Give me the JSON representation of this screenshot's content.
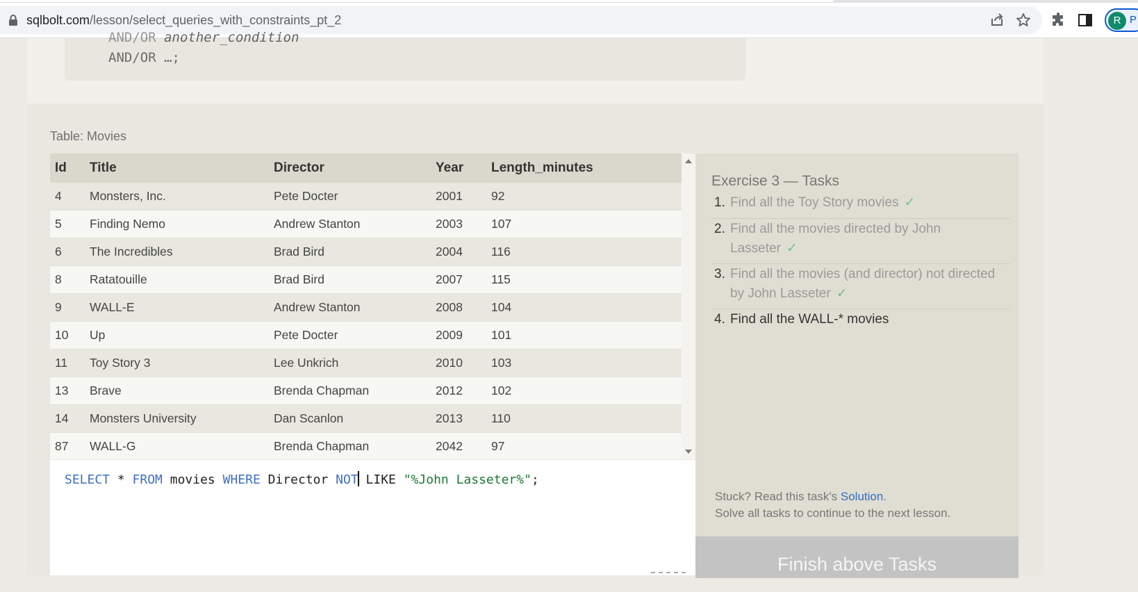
{
  "browser": {
    "url_host": "sqlbolt.com",
    "url_path": "/lesson/select_queries_with_constraints_pt_2",
    "profile_initial": "R",
    "profile_label_partial": "P"
  },
  "syntax_block": {
    "line1_kw": "AND/OR",
    "line1_italic": "another_condition",
    "line2": "AND/OR …;"
  },
  "table": {
    "label": "Table: Movies",
    "columns": [
      "Id",
      "Title",
      "Director",
      "Year",
      "Length_minutes"
    ],
    "rows": [
      [
        "4",
        "Monsters, Inc.",
        "Pete Docter",
        "2001",
        "92"
      ],
      [
        "5",
        "Finding Nemo",
        "Andrew Stanton",
        "2003",
        "107"
      ],
      [
        "6",
        "The Incredibles",
        "Brad Bird",
        "2004",
        "116"
      ],
      [
        "8",
        "Ratatouille",
        "Brad Bird",
        "2007",
        "115"
      ],
      [
        "9",
        "WALL-E",
        "Andrew Stanton",
        "2008",
        "104"
      ],
      [
        "10",
        "Up",
        "Pete Docter",
        "2009",
        "101"
      ],
      [
        "11",
        "Toy Story 3",
        "Lee Unkrich",
        "2010",
        "103"
      ],
      [
        "13",
        "Brave",
        "Brenda Chapman",
        "2012",
        "102"
      ],
      [
        "14",
        "Monsters University",
        "Dan Scanlon",
        "2013",
        "110"
      ],
      [
        "87",
        "WALL-G",
        "Brenda Chapman",
        "2042",
        "97"
      ]
    ]
  },
  "editor": {
    "tokens": {
      "select": "SELECT",
      "star": " * ",
      "from": "FROM",
      "movies": " movies ",
      "where": "WHERE",
      "director": " Director ",
      "not": "NOT",
      "like": " LIKE ",
      "string": "\"%John Lasseter%\"",
      "end": ";"
    }
  },
  "tasks": {
    "title": "Exercise 3 — Tasks",
    "items": [
      {
        "num": "1.",
        "text": "Find all the Toy Story movies",
        "done": "✓"
      },
      {
        "num": "2.",
        "text": "Find all the movies directed by John Lasseter",
        "done": "✓"
      },
      {
        "num": "3.",
        "text": "Find all the movies (and director) not directed by John Lasseter",
        "done": "✓"
      },
      {
        "num": "4.",
        "text": "Find all the WALL-* movies",
        "done": ""
      }
    ],
    "stuck_prefix": "Stuck? Read this task's ",
    "solution_link": "Solution",
    "stuck_suffix": ".",
    "continue_note": "Solve all tasks to continue to the next lesson.",
    "finish_button": "Finish above Tasks"
  },
  "colors": {
    "keyword": "#3f6ec5",
    "string": "#1d7a2f",
    "check": "#6fc48a",
    "link": "#2f6fc9"
  }
}
